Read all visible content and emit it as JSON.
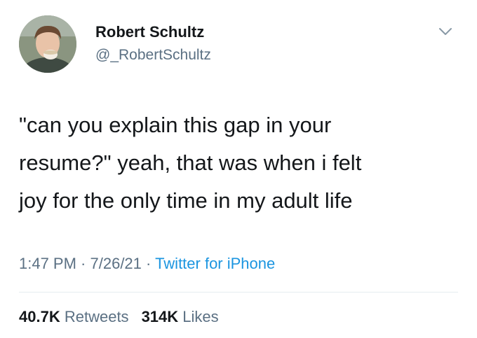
{
  "author": {
    "name": "Robert Schultz",
    "handle": "@_RobertSchultz",
    "avatar_icon": "profile-photo"
  },
  "menu_icon": "chevron-down-icon",
  "tweet": {
    "lines": [
      "\"can you explain this gap in your",
      "resume?\" yeah, that was when i felt",
      "joy for the only time in my adult life"
    ]
  },
  "meta": {
    "time": "1:47 PM",
    "sep1": " · ",
    "date": "7/26/21",
    "sep2": " · ",
    "source": "Twitter for iPhone"
  },
  "stats": {
    "retweets_count": "40.7K",
    "retweets_label": "Retweets",
    "likes_count": "314K",
    "likes_label": "Likes"
  },
  "colors": {
    "text_primary": "#14171a",
    "text_secondary": "#5b7083",
    "link": "#1b95e0",
    "divider": "#e6ecf0"
  }
}
